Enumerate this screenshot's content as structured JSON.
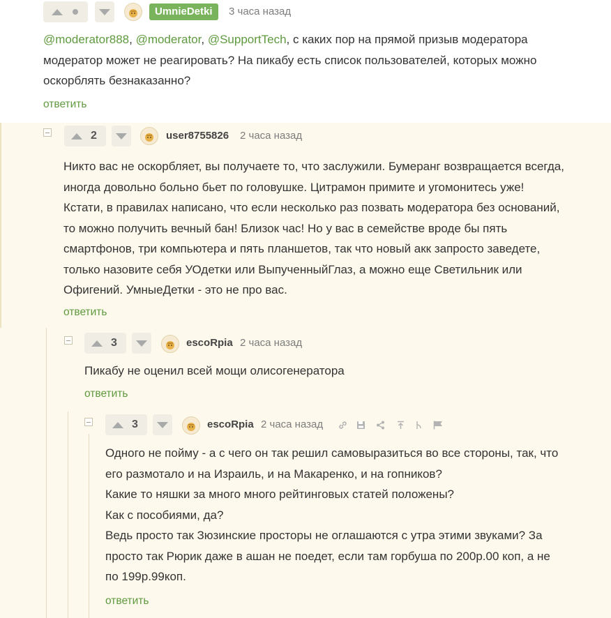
{
  "comments": [
    {
      "score": "",
      "author": "UmnieDetki",
      "time": "3 часа назад",
      "mentions": [
        "@moderator888",
        "@moderator",
        "@SupportTech"
      ],
      "text_after_mentions": ", с каких пор на прямой призыв модератора",
      "lines": [
        "модератор может не реагировать? На пикабу есть список пользователей, которых можно",
        "оскорблять безнаказанно?"
      ],
      "reply_label": "ответить"
    },
    {
      "score": "2",
      "author": "user8755826",
      "time": "2 часа назад",
      "lines": [
        "Никто вас не оскорбляет, вы получаете то, что заслужили. Бумеранг возвращается всегда,",
        "иногда довольно больно бьет по головушке. Цитрамон примите и угомонитесь уже!",
        "Кстати, в правилах написано, что если несколько раз позвать модератора без оснований,",
        "то можно получить вечный бан! Близок час! Но у вас в семействе вроде бы пять",
        "смартфонов, три компьютера и пять планшетов, так что новый акк запросто заведете,",
        "только назовите себя УОдетки или ВыпученныйГлаз, а можно еще Светильник или",
        "Офигений. УмныеДетки - это не про вас."
      ],
      "reply_label": "ответить"
    },
    {
      "score": "3",
      "author": "escoRpia",
      "time": "2 часа назад",
      "lines": [
        "Пикабу не оценил всей мощи олисогенератора"
      ],
      "reply_label": "ответить"
    },
    {
      "score": "3",
      "author": "escoRpia",
      "time": "2 часа назад",
      "lines": [
        "Одного не пойму - а с чего он так решил самовыразиться во все стороны, так, что",
        "его размотало и на Израиль, и на Макаренко, и на гопников?",
        "Какие то няшки за много много рейтинговых статей положены?",
        "Как с пособиями, да?",
        "Ведь просто так Зюзинские просторы не оглашаются с утра этими звуками? За",
        "просто так Рюрик даже в ашан не поедет, если там горбуша по 200р.00 коп, а не",
        "по 199р.99коп."
      ],
      "reply_label": "ответить",
      "tools": [
        "link-icon",
        "save-icon",
        "share-icon",
        "go-to-parent-icon",
        "branch-icon",
        "report-flag-icon"
      ]
    }
  ],
  "colors": {
    "accent_green": "#5f9a3f",
    "badge_green": "#79b45c",
    "highlight_background": "#fdf9ec"
  }
}
